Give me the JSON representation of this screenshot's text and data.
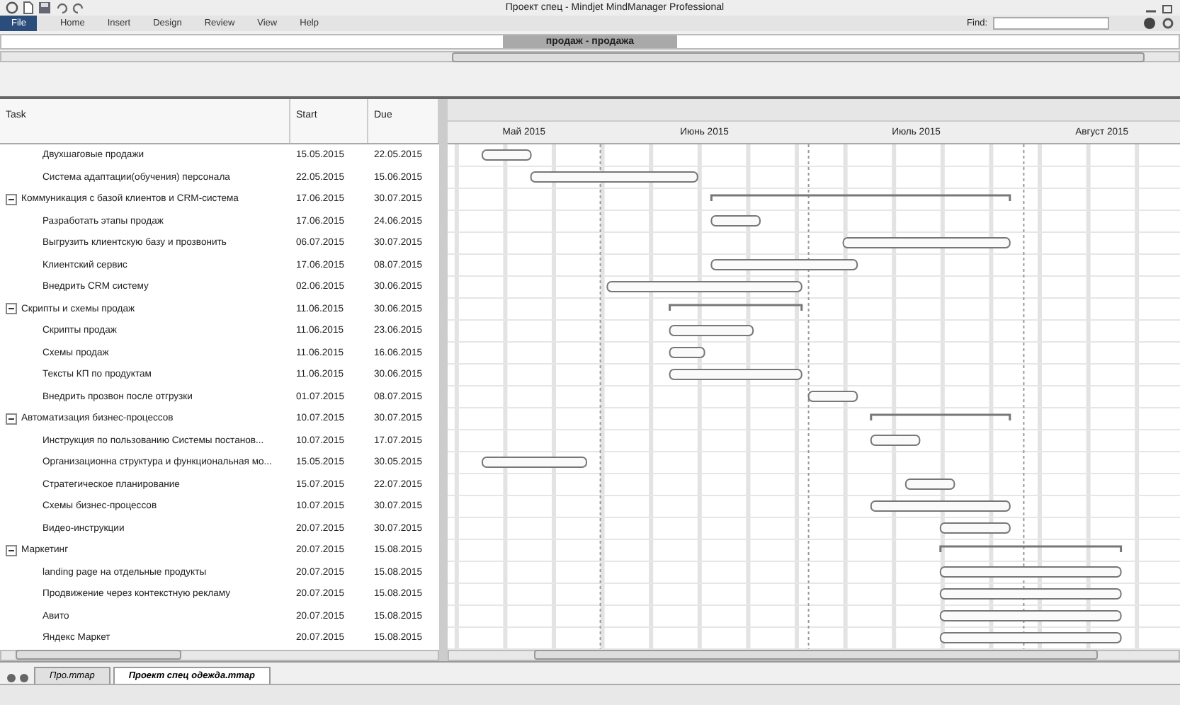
{
  "window": {
    "title": "Проект спец - Mindjet MindManager Professional"
  },
  "ribbon_tabs": [
    {
      "label": "File",
      "kind": "backstage"
    },
    {
      "label": "Home",
      "kind": "tab"
    },
    {
      "label": "Insert",
      "kind": "tab"
    },
    {
      "label": "Design",
      "kind": "tab"
    },
    {
      "label": "Review",
      "kind": "tab"
    },
    {
      "label": "View",
      "kind": "tab"
    },
    {
      "label": "Help",
      "kind": "tab"
    }
  ],
  "find": {
    "label": "Find:"
  },
  "topic_bar": {
    "label": "продаж - продажа"
  },
  "columns": [
    "Task",
    "Start",
    "Due"
  ],
  "timeline": {
    "months": [
      "Май 2015",
      "Июнь 2015",
      "Июль 2015",
      "Август 2015"
    ]
  },
  "tasks": [
    {
      "name": "Двухшаговые продажи",
      "start": "15.05.2015",
      "due": "22.05.2015"
    },
    {
      "name": "Система адаптации(обучения) персонала",
      "start": "22.05.2015",
      "due": "15.06.2015"
    },
    {
      "name": "Коммуникация с базой клиентов и CRM-система",
      "start": "17.06.2015",
      "due": "30.07.2015",
      "expanded": true,
      "children": [
        {
          "name": "Разработать этапы продаж",
          "start": "17.06.2015",
          "due": "24.06.2015"
        },
        {
          "name": "Выгрузить клиентскую базу и прозвонить",
          "start": "06.07.2015",
          "due": "30.07.2015"
        },
        {
          "name": "Клиентский сервис",
          "start": "17.06.2015",
          "due": "08.07.2015"
        },
        {
          "name": "Внедрить CRM систему",
          "start": "02.06.2015",
          "due": "30.06.2015"
        }
      ]
    },
    {
      "name": "Скрипты и схемы продаж",
      "start": "11.06.2015",
      "due": "30.06.2015",
      "expanded": true,
      "children": [
        {
          "name": "Скрипты продаж",
          "start": "11.06.2015",
          "due": "23.06.2015"
        },
        {
          "name": "Схемы продаж",
          "start": "11.06.2015",
          "due": "16.06.2015"
        },
        {
          "name": "Тексты КП по продуктам",
          "start": "11.06.2015",
          "due": "30.06.2015"
        },
        {
          "name": "Внедрить прозвон после отгрузки",
          "start": "01.07.2015",
          "due": "08.07.2015"
        }
      ]
    },
    {
      "name": "Автоматизация бизнес-процессов",
      "start": "10.07.2015",
      "due": "30.07.2015",
      "expanded": true,
      "children": [
        {
          "name": "Инструкция по пользованию Системы постанов...",
          "start": "10.07.2015",
          "due": "17.07.2015"
        },
        {
          "name": "Организационна структура и функциональная мо...",
          "start": "15.05.2015",
          "due": "30.05.2015"
        },
        {
          "name": "Стратегическое планирование",
          "start": "15.07.2015",
          "due": "22.07.2015"
        },
        {
          "name": "Схемы бизнес-процессов",
          "start": "10.07.2015",
          "due": "30.07.2015"
        },
        {
          "name": "Видео-инструкции",
          "start": "20.07.2015",
          "due": "30.07.2015"
        }
      ]
    },
    {
      "name": "Маркетинг",
      "start": "20.07.2015",
      "due": "15.08.2015",
      "expanded": true,
      "children": [
        {
          "name": "landing page на отдельные продукты",
          "start": "20.07.2015",
          "due": "15.08.2015"
        },
        {
          "name": "Продвижение через контекстную рекламу",
          "start": "20.07.2015",
          "due": "15.08.2015"
        },
        {
          "name": "Авито",
          "start": "20.07.2015",
          "due": "15.08.2015"
        },
        {
          "name": "Яндекс Маркет",
          "start": "20.07.2015",
          "due": "15.08.2015"
        }
      ]
    }
  ],
  "document_tabs": [
    {
      "label": "Про.mmap",
      "selected": false
    },
    {
      "label": "Проект спец одежда.mmap",
      "selected": true
    }
  ]
}
